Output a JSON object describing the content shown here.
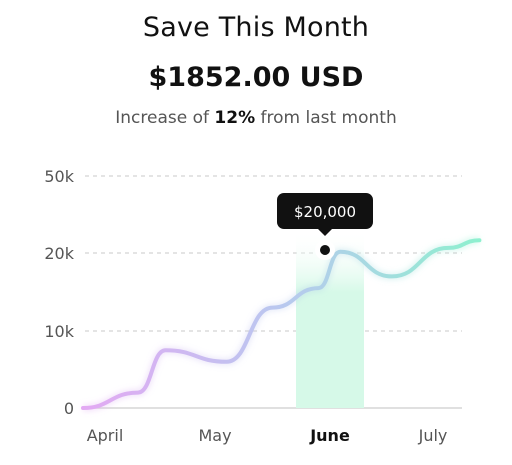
{
  "header": {
    "title": "Save This Month",
    "amount": "$1852.00 USD",
    "subtitle_prefix": "Increase of ",
    "subtitle_highlight": "12%",
    "subtitle_suffix": " from last month"
  },
  "colors": {
    "line_start": "#e3a9f3",
    "line_mid": "#b9c8ef",
    "line_end": "#8ef0cf",
    "highlight_band": "#d6f9e8",
    "tooltip_bg": "#111111"
  },
  "chart_data": {
    "type": "line",
    "title": "",
    "xlabel": "",
    "ylabel": "",
    "y_ticks": [
      "0",
      "10k",
      "20k",
      "50k"
    ],
    "categories": [
      "April",
      "May",
      "June",
      "July"
    ],
    "active_category": "June",
    "tooltip": "$20,000",
    "tooltip_point": {
      "x": 2.0,
      "y": 20000
    },
    "series": [
      {
        "values": [
          {
            "x": -0.2,
            "y": 0
          },
          {
            "x": 0.3,
            "y": 2000
          },
          {
            "x": 0.55,
            "y": 7500
          },
          {
            "x": 1.1,
            "y": 6000
          },
          {
            "x": 1.5,
            "y": 13000
          },
          {
            "x": 1.9,
            "y": 15500
          },
          {
            "x": 2.1,
            "y": 20500
          },
          {
            "x": 2.6,
            "y": 17000
          },
          {
            "x": 3.15,
            "y": 22000
          },
          {
            "x": 3.45,
            "y": 25000
          }
        ]
      }
    ]
  }
}
